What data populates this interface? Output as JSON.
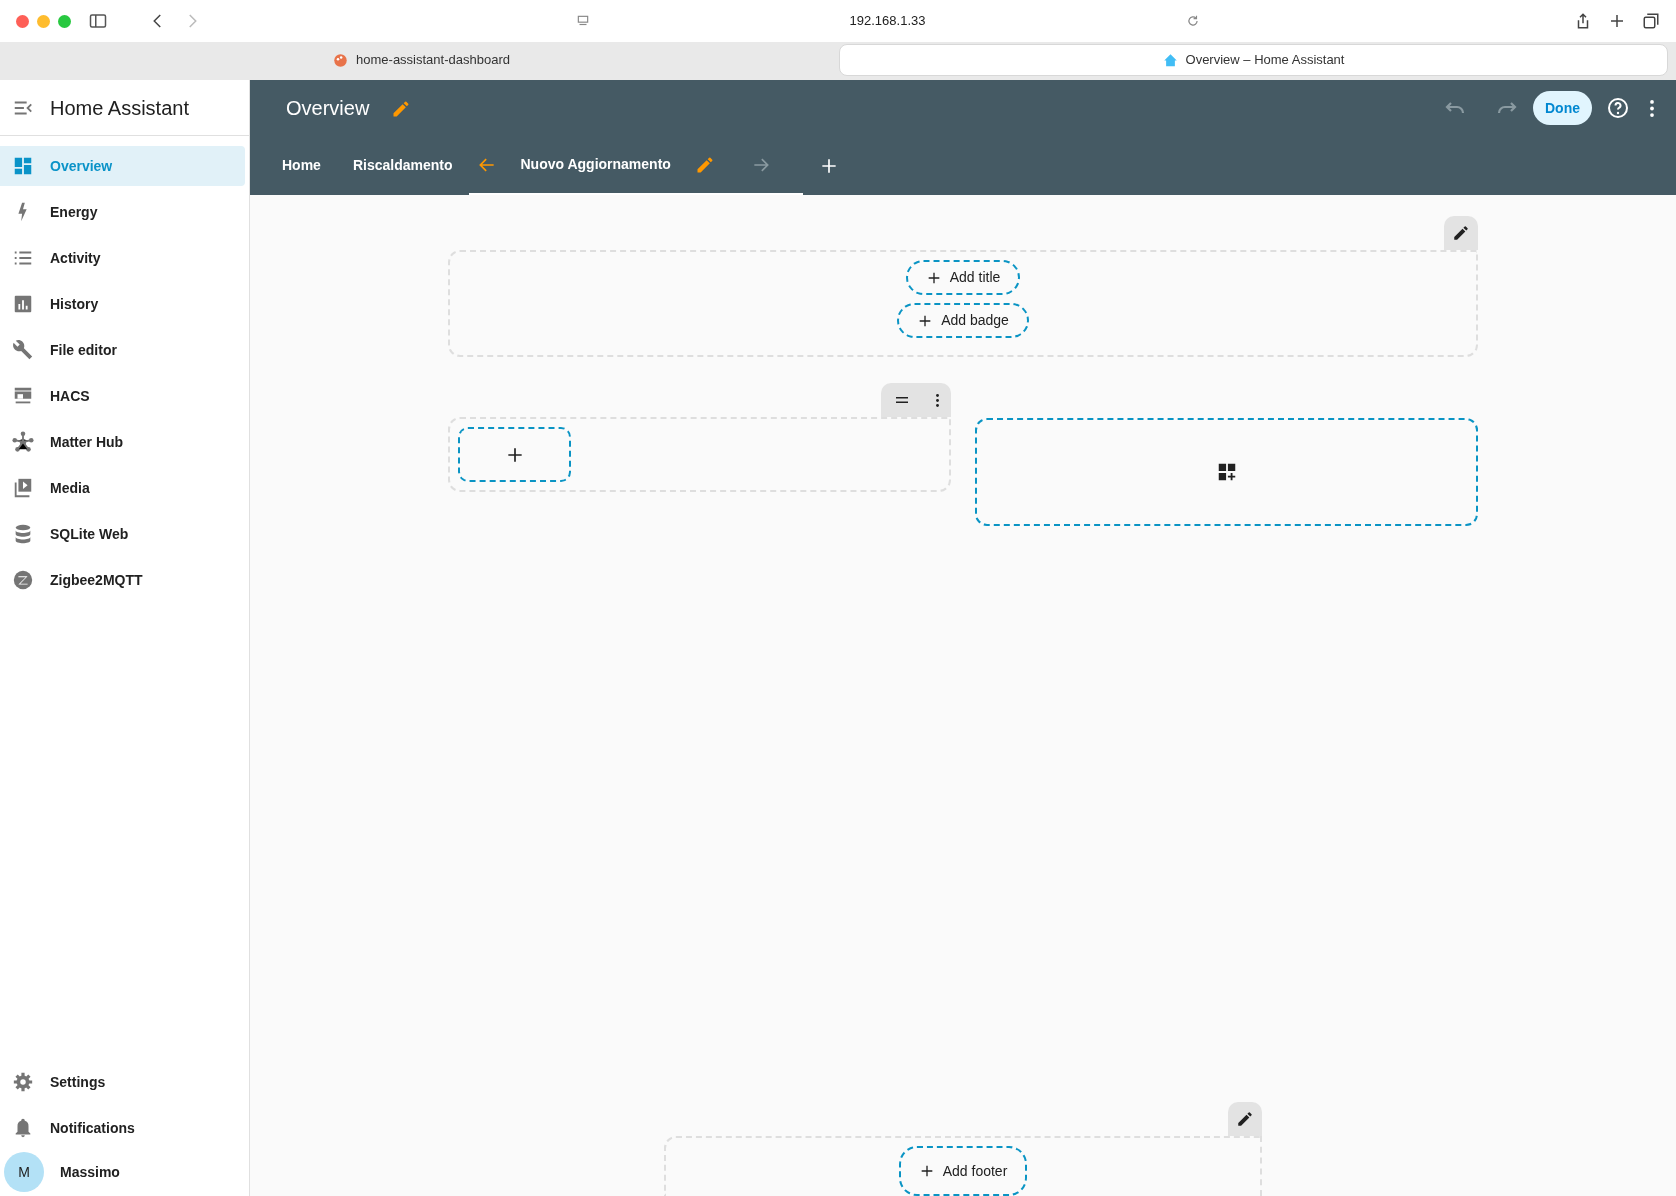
{
  "browser": {
    "url": "192.168.1.33",
    "tabs": [
      {
        "title": "home-assistant-dashboard",
        "selected": false
      },
      {
        "title": "Overview – Home Assistant",
        "selected": true
      }
    ]
  },
  "sidebar": {
    "title": "Home Assistant",
    "items": [
      {
        "label": "Overview",
        "selected": true
      },
      {
        "label": "Energy",
        "selected": false
      },
      {
        "label": "Activity",
        "selected": false
      },
      {
        "label": "History",
        "selected": false
      },
      {
        "label": "File editor",
        "selected": false
      },
      {
        "label": "HACS",
        "selected": false
      },
      {
        "label": "Matter Hub",
        "selected": false
      },
      {
        "label": "Media",
        "selected": false
      },
      {
        "label": "SQLite Web",
        "selected": false
      },
      {
        "label": "Zigbee2MQTT",
        "selected": false
      }
    ],
    "bottom_items": [
      {
        "label": "Settings"
      },
      {
        "label": "Notifications"
      }
    ],
    "user": {
      "initial": "M",
      "name": "Massimo"
    }
  },
  "header": {
    "title": "Overview",
    "undo": {
      "disabled": true
    },
    "redo": {
      "disabled": true
    },
    "done_label": "Done",
    "tabs": [
      {
        "label": "Home",
        "selected": false
      },
      {
        "label": "Riscaldamento",
        "selected": false
      },
      {
        "label": "Nuovo Aggiornamento",
        "selected": true
      }
    ]
  },
  "content": {
    "header_buttons": [
      "Add title",
      "Add badge"
    ],
    "footer_button": "Add footer"
  }
}
